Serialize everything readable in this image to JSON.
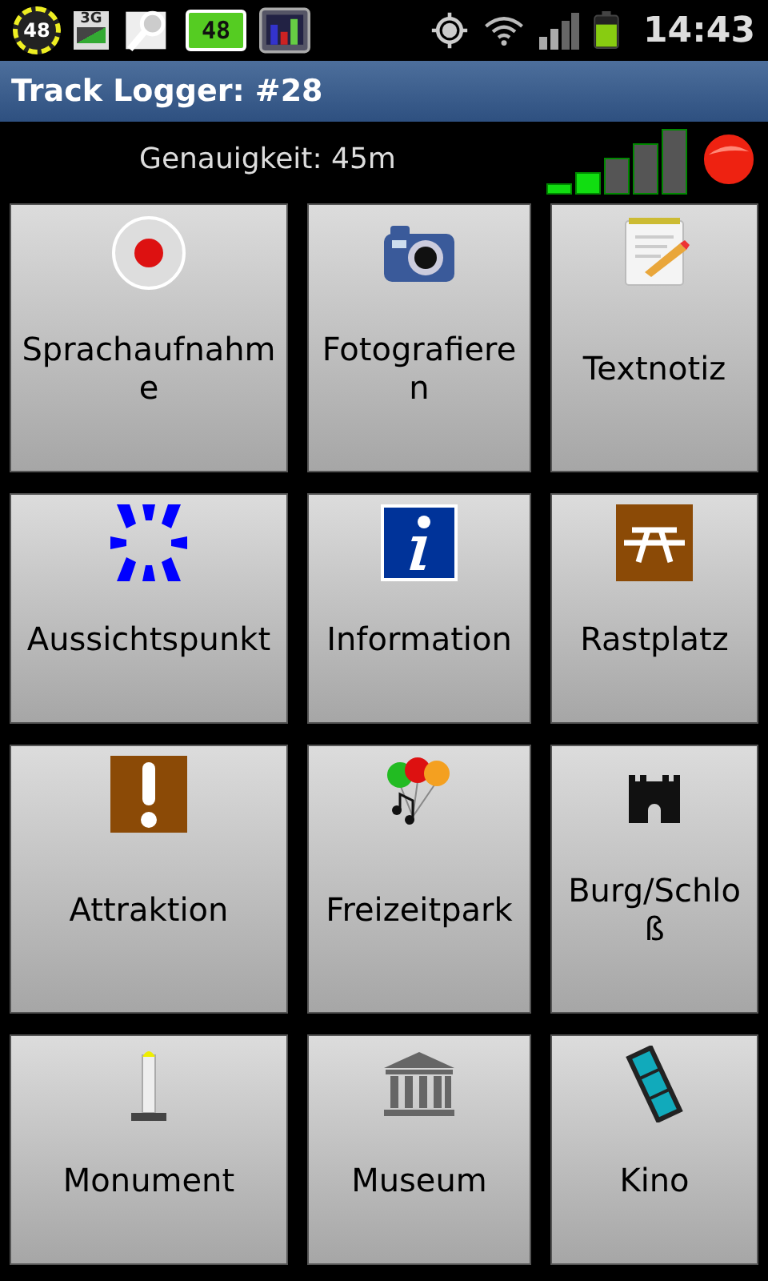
{
  "status_bar": {
    "notifications": [
      {
        "kind": "gauge",
        "text": "48"
      },
      {
        "kind": "network",
        "text": "3G"
      },
      {
        "kind": "search"
      },
      {
        "kind": "counter",
        "text": "48"
      },
      {
        "kind": "chart"
      }
    ],
    "time": "14:43"
  },
  "title": "Track Logger: #28",
  "accuracy": "Genauigkeit: 45m",
  "tiles": [
    {
      "kind": "record",
      "label": "Sprachaufnahme"
    },
    {
      "kind": "camera",
      "label": "Fotografieren"
    },
    {
      "kind": "note",
      "label": "Textnotiz"
    },
    {
      "kind": "viewpoint",
      "label": "Aussichtspunkt"
    },
    {
      "kind": "info",
      "label": "Information"
    },
    {
      "kind": "picnic",
      "label": "Rastplatz"
    },
    {
      "kind": "attraction",
      "label": "Attraktion"
    },
    {
      "kind": "balloons",
      "label": "Freizeitpark"
    },
    {
      "kind": "castle",
      "label": "Burg/Schloß"
    },
    {
      "kind": "monument",
      "label": "Monument"
    },
    {
      "kind": "museum",
      "label": "Museum"
    },
    {
      "kind": "film",
      "label": "Kino"
    }
  ]
}
